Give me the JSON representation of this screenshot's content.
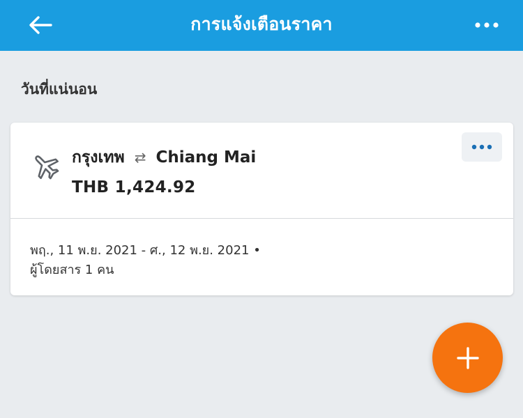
{
  "header": {
    "title": "การแจ้งเตือนราคา",
    "back_icon": "arrow-left-icon",
    "more_icon": "more-horizontal-icon",
    "background_color": "#1a9de0"
  },
  "section": {
    "label": "วันที่แน่นอน"
  },
  "alert_card": {
    "origin": "กรุงเทพ",
    "route_icon": "swap-arrows-icon",
    "destination": "Chiang Mai",
    "price": "THB 1,424.92",
    "dates": "พฤ., 11 พ.ย. 2021 - ศ., 12 พ.ย. 2021 •",
    "passengers": "ผู้โดยสาร 1 คน",
    "icon": "airplane-icon",
    "menu_icon": "more-horizontal-icon"
  },
  "fab": {
    "icon": "plus-icon",
    "color": "#f5730f"
  }
}
